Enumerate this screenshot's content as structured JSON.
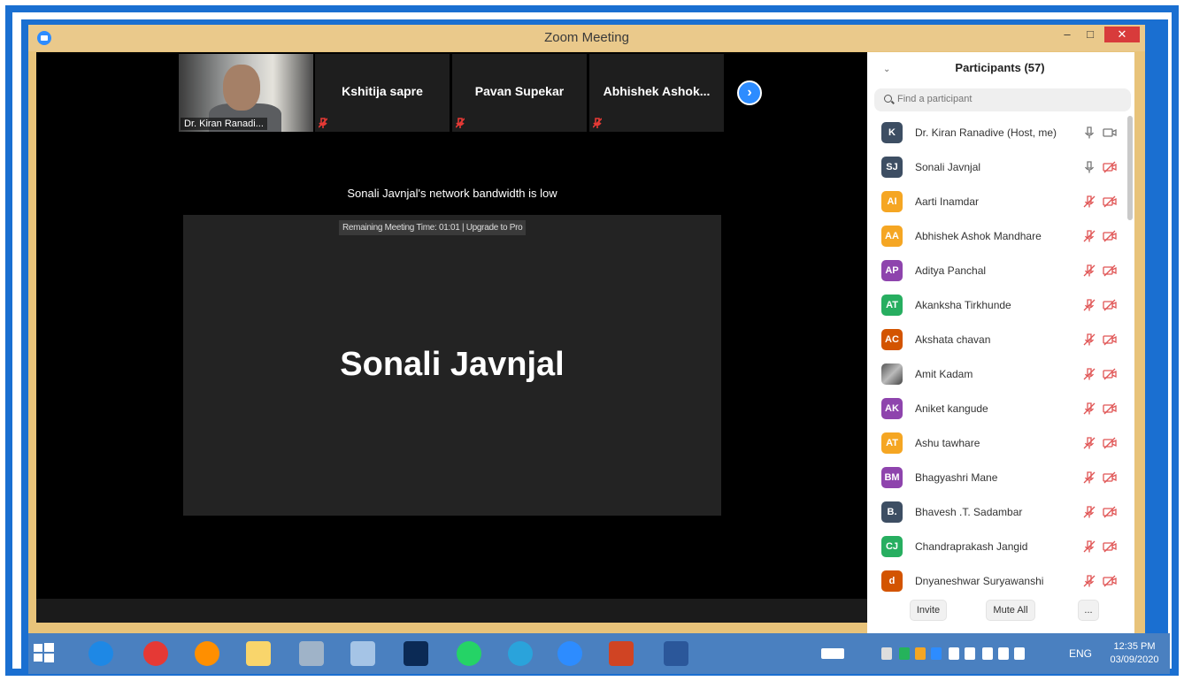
{
  "window": {
    "title": "Zoom Meeting",
    "minimize_label": "–",
    "maximize_label": "□",
    "close_label": "✕"
  },
  "strip": {
    "self_name": "Dr. Kiran Ranadi...",
    "thumbs": [
      "Kshitija sapre",
      "Pavan Supekar",
      "Abhishek  Ashok..."
    ],
    "next_icon": "›"
  },
  "main": {
    "bandwidth_message": "Sonali Javnjal's network bandwidth is low",
    "remaining_time": "Remaining Meeting Time: 01:01 | Upgrade to Pro",
    "active_speaker": "Sonali Javnjal"
  },
  "panel": {
    "chevron": "⌄",
    "title": "Participants (57)",
    "search_placeholder": "Find a participant",
    "invite_label": "Invite",
    "mute_all_label": "Mute All",
    "more_label": "...",
    "participants": [
      {
        "initials": "K",
        "name": "Dr. Kiran Ranadive (Host, me)",
        "color": "#3d4e63",
        "mic": "on",
        "video": "on"
      },
      {
        "initials": "SJ",
        "name": "Sonali Javnjal",
        "color": "#3d4e63",
        "mic": "on",
        "video": "off"
      },
      {
        "initials": "AI",
        "name": "Aarti Inamdar",
        "color": "#f5a623",
        "mic": "off",
        "video": "off"
      },
      {
        "initials": "AA",
        "name": "Abhishek Ashok Mandhare",
        "color": "#f5a623",
        "mic": "off",
        "video": "off"
      },
      {
        "initials": "AP",
        "name": "Aditya Panchal",
        "color": "#8e44ad",
        "mic": "off",
        "video": "off"
      },
      {
        "initials": "AT",
        "name": "Akanksha Tirkhunde",
        "color": "#27ae60",
        "mic": "off",
        "video": "off"
      },
      {
        "initials": "AC",
        "name": "Akshata chavan",
        "color": "#d35400",
        "mic": "off",
        "video": "off"
      },
      {
        "initials": "",
        "name": "Amit Kadam",
        "color": "#7f8c8d",
        "mic": "off",
        "video": "off",
        "photo": true
      },
      {
        "initials": "AK",
        "name": "Aniket kangude",
        "color": "#8e44ad",
        "mic": "off",
        "video": "off"
      },
      {
        "initials": "AT",
        "name": "Ashu tawhare",
        "color": "#f5a623",
        "mic": "off",
        "video": "off"
      },
      {
        "initials": "BM",
        "name": "Bhagyashri Mane",
        "color": "#8e44ad",
        "mic": "off",
        "video": "off"
      },
      {
        "initials": "B.",
        "name": "Bhavesh .T. Sadambar",
        "color": "#3d4e63",
        "mic": "off",
        "video": "off"
      },
      {
        "initials": "CJ",
        "name": "Chandraprakash Jangid",
        "color": "#27ae60",
        "mic": "off",
        "video": "off"
      },
      {
        "initials": "d",
        "name": "Dnyaneshwar Suryawanshi",
        "color": "#d35400",
        "mic": "off",
        "video": "off"
      }
    ]
  },
  "taskbar": {
    "lang": "ENG",
    "time": "12:35 PM",
    "date": "03/09/2020",
    "apps": [
      "windows-start",
      "internet-explorer",
      "chrome",
      "firefox",
      "file-explorer",
      "calculator",
      "paint",
      "photoshop",
      "whatsapp",
      "telegram",
      "zoom",
      "powerpoint",
      "word"
    ]
  }
}
